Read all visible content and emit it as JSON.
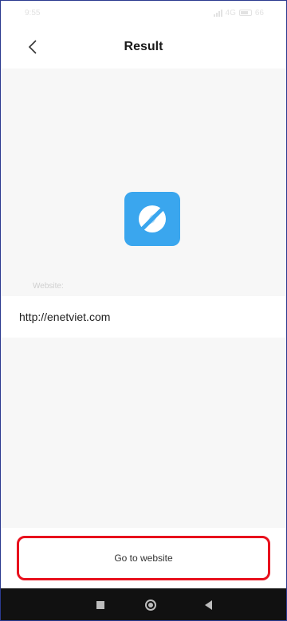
{
  "status_bar": {
    "time": "9:55",
    "network": "4G",
    "battery": "66"
  },
  "app_bar": {
    "title": "Result",
    "back_icon": "chevron-left-icon"
  },
  "result": {
    "icon": "browser-compass-icon",
    "icon_color": "#3aa6ee",
    "field_label": "Website:",
    "url": "http://enetviet.com"
  },
  "actions": {
    "go_label": "Go to website",
    "highlight_color": "#e8101d"
  },
  "nav": {
    "recents_icon": "square-icon",
    "home_icon": "circle-icon",
    "back_icon": "triangle-back-icon"
  }
}
